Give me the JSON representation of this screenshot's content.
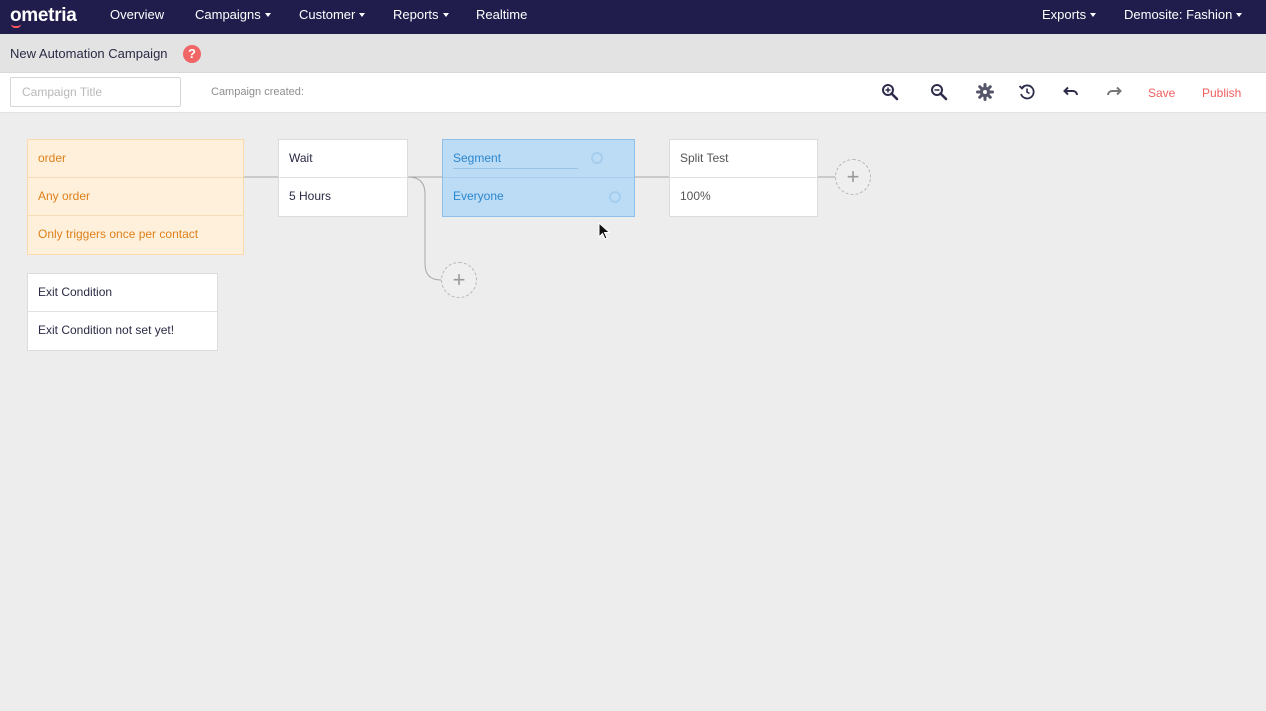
{
  "nav": {
    "logo": "ometria",
    "items": [
      {
        "label": "Overview",
        "caret": false
      },
      {
        "label": "Campaigns",
        "caret": true
      },
      {
        "label": "Customer",
        "caret": true
      },
      {
        "label": "Reports",
        "caret": true
      },
      {
        "label": "Realtime",
        "caret": false
      }
    ],
    "right_items": [
      {
        "label": "Exports",
        "caret": true
      },
      {
        "label": "Demosite: Fashion",
        "caret": true
      }
    ]
  },
  "header": {
    "title": "New Automation Campaign",
    "help_icon": "?"
  },
  "toolbar": {
    "title_placeholder": "Campaign Title",
    "title_value": "",
    "created_label": "Campaign created:",
    "icons": [
      "zoom-in-icon",
      "zoom-out-icon",
      "gear-icon",
      "history-icon",
      "undo-icon",
      "redo-icon"
    ],
    "save_label": "Save",
    "publish_label": "Publish"
  },
  "flow": {
    "trigger": {
      "title": "order",
      "rows": [
        "Any order",
        "Only triggers once per contact"
      ]
    },
    "wait": {
      "title": "Wait",
      "value": "5 Hours"
    },
    "segment": {
      "title": "Segment",
      "value": "Everyone"
    },
    "split": {
      "title": "Split Test",
      "value": "100%"
    },
    "exit": {
      "title": "Exit Condition",
      "value": "Exit Condition not set yet!"
    },
    "add_symbol": "+"
  },
  "colors": {
    "nav_bg": "#201d4d",
    "accent": "#ef5f5f",
    "trigger_bg": "#fff0dc",
    "trigger_text": "#de8019",
    "segment_bg": "#bcdcf5",
    "segment_text": "#2a86cf"
  }
}
